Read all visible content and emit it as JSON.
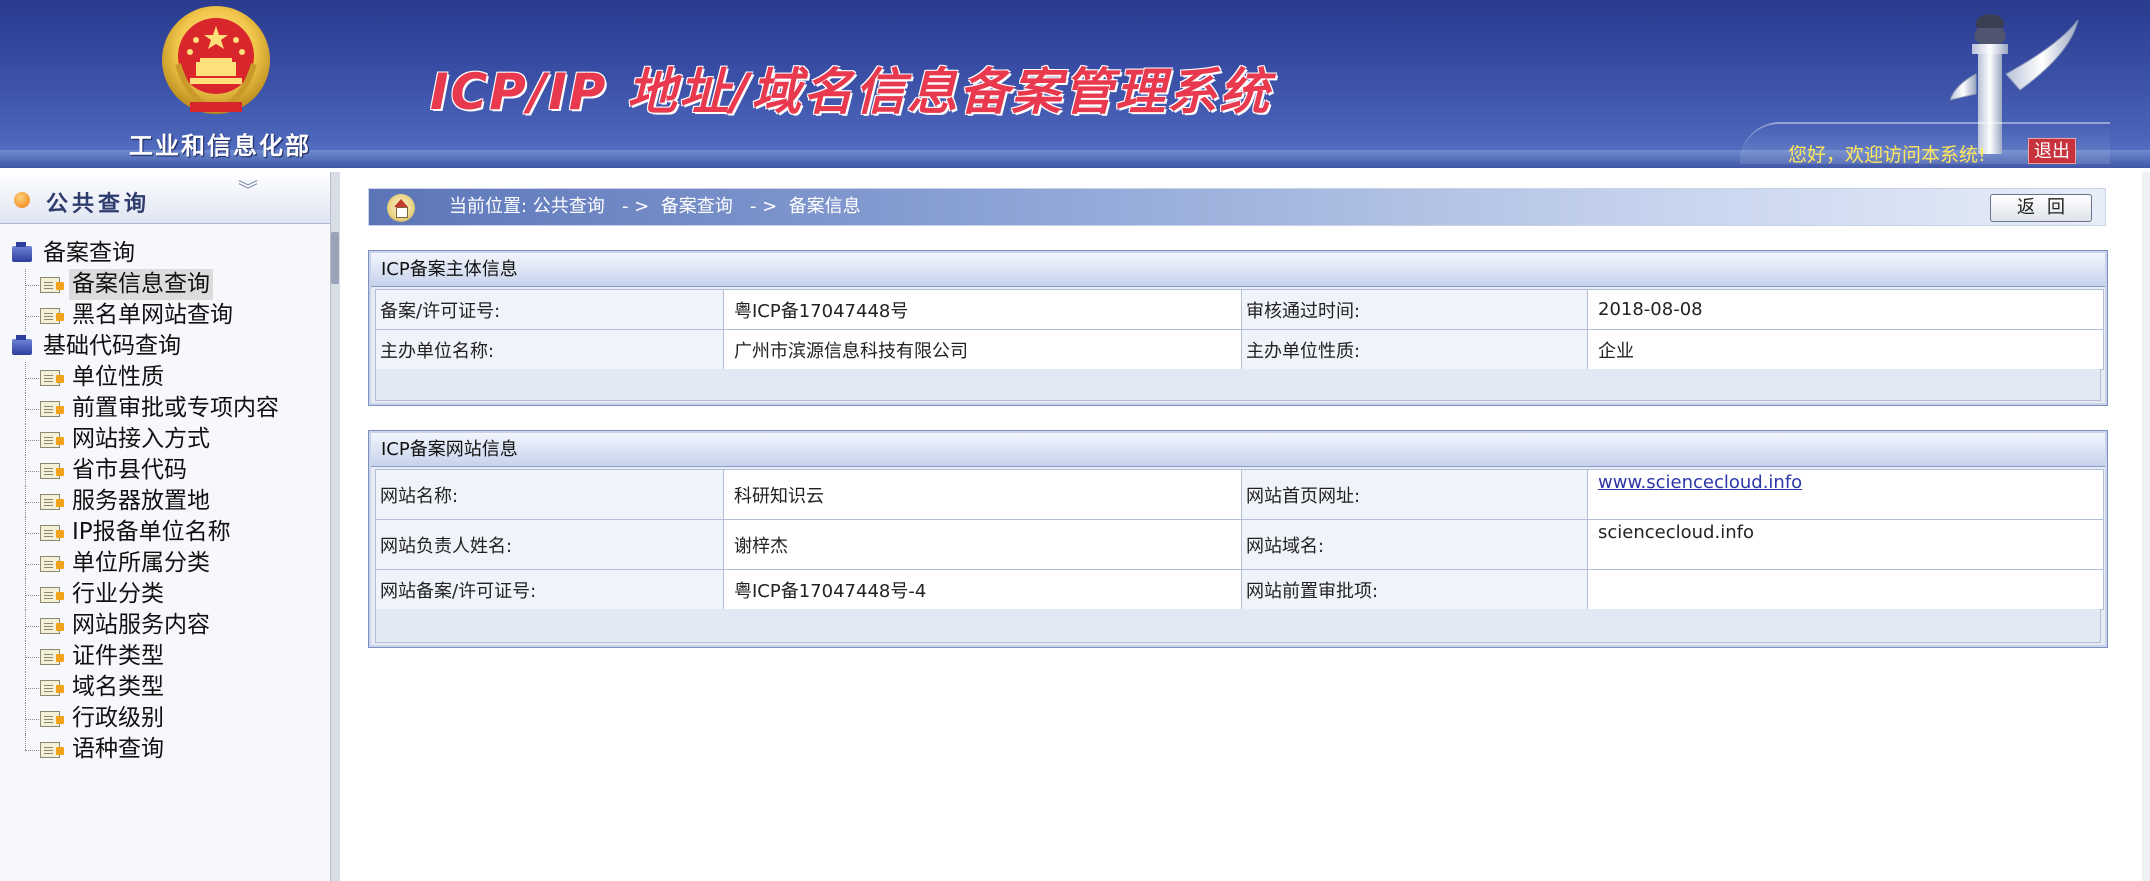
{
  "header": {
    "ministry": "工业和信息化部",
    "system_title": "ICP/IP 地址/域名信息备案管理系统",
    "welcome": "您好，欢迎访问本系统!",
    "logout": "退出"
  },
  "sidebar": {
    "title": "公共查询",
    "tree": [
      {
        "label": "备案查询",
        "type": "folder",
        "children": [
          {
            "label": "备案信息查询",
            "selected": true
          },
          {
            "label": "黑名单网站查询"
          }
        ]
      },
      {
        "label": "基础代码查询",
        "type": "folder",
        "children": [
          {
            "label": "单位性质"
          },
          {
            "label": "前置审批或专项内容"
          },
          {
            "label": "网站接入方式"
          },
          {
            "label": "省市县代码"
          },
          {
            "label": "服务器放置地"
          },
          {
            "label": "IP报备单位名称"
          },
          {
            "label": "单位所属分类"
          },
          {
            "label": "行业分类"
          },
          {
            "label": "网站服务内容"
          },
          {
            "label": "证件类型"
          },
          {
            "label": "域名类型"
          },
          {
            "label": "行政级别"
          },
          {
            "label": "语种查询"
          }
        ]
      }
    ]
  },
  "breadcrumb": {
    "text": "当前位置: 公共查询   - >  备案查询   - >  备案信息"
  },
  "back_button": "返回",
  "panels": {
    "subject": {
      "title": "ICP备案主体信息",
      "rows": [
        {
          "k1": "备案/许可证号:",
          "v1": "粤ICP备17047448号",
          "k2": "审核通过时间:",
          "v2": "2018-08-08"
        },
        {
          "k1": "主办单位名称:",
          "v1": "广州市滨源信息科技有限公司",
          "k2": "主办单位性质:",
          "v2": "企业"
        }
      ]
    },
    "website": {
      "title": "ICP备案网站信息",
      "rows": [
        {
          "k1": "网站名称:",
          "v1": "科研知识云",
          "k2": "网站首页网址:",
          "v2": "www.sciencecloud.info"
        },
        {
          "k1": "网站负责人姓名:",
          "v1": "谢梓杰",
          "k2": "网站域名:",
          "v2": "sciencecloud.info"
        },
        {
          "k1": "网站备案/许可证号:",
          "v1": "粤ICP备17047448号-4",
          "k2": "网站前置审批项:",
          "v2": ""
        }
      ]
    }
  },
  "colors": {
    "header_blue": "#3a4fa6",
    "title_red": "#e8394f",
    "welcome_yellow": "#ffe85a",
    "logout_red": "#c8323d",
    "link_blue": "#2b36a8"
  },
  "icons": [
    "national-emblem-icon",
    "huabiao-pillar-icon",
    "home-icon",
    "folder-icon",
    "document-icon",
    "orange-dot-icon",
    "chevron-double-down-icon"
  ]
}
